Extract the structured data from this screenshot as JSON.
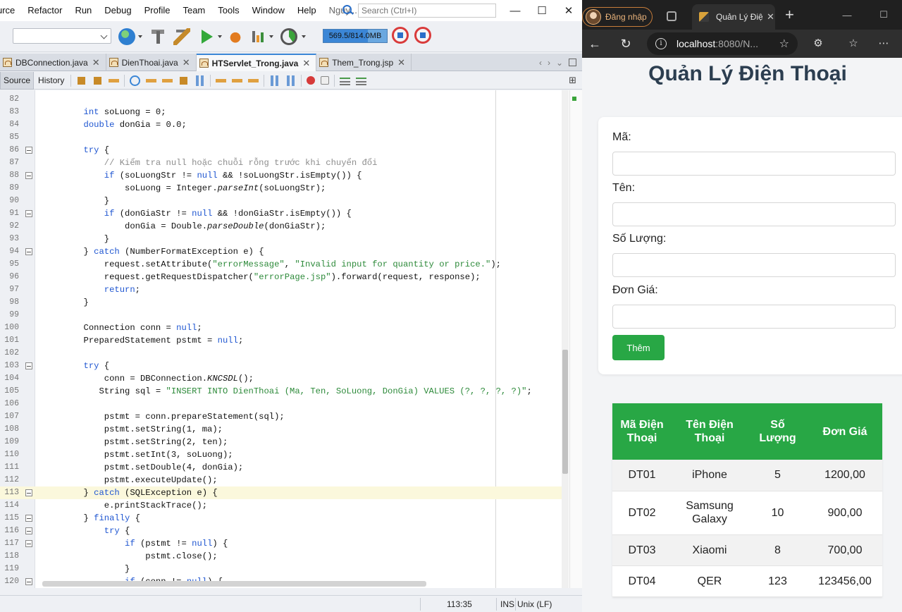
{
  "ide": {
    "menu": [
      "urce",
      "Refactor",
      "Run",
      "Debug",
      "Profile",
      "Team",
      "Tools",
      "Window",
      "Help",
      "Nguy..."
    ],
    "search_placeholder": "Search (Ctrl+I)",
    "memory_label": "569.5/814.0MB",
    "memory_fraction": 0.7,
    "tabs": [
      {
        "label": "DBConnection.java",
        "active": false
      },
      {
        "label": "DienThoai.java",
        "active": false
      },
      {
        "label": "HTServlet_Trong.java",
        "active": true
      },
      {
        "label": "Them_Trong.jsp",
        "active": false
      }
    ],
    "editor_tabs": {
      "source": "Source",
      "history": "History"
    },
    "cursor_line": 113,
    "code": [
      {
        "n": "82",
        "fold": false,
        "t": ""
      },
      {
        "n": "83",
        "fold": false,
        "t": "        <span class=\"kw\">int</span> soLuong = 0;"
      },
      {
        "n": "84",
        "fold": false,
        "t": "        <span class=\"kw\">double</span> donGia = 0.0;"
      },
      {
        "n": "85",
        "fold": false,
        "t": ""
      },
      {
        "n": "86",
        "fold": true,
        "t": "        <span class=\"kw\">try</span> {"
      },
      {
        "n": "87",
        "fold": false,
        "t": "            <span class=\"cmt\">// Kiểm tra null hoặc chuỗi rỗng trước khi chuyển đổi</span>"
      },
      {
        "n": "88",
        "fold": true,
        "t": "            <span class=\"kw\">if</span> (soLuongStr != <span class=\"kw\">null</span> &amp;&amp; !soLuongStr.isEmpty()) {"
      },
      {
        "n": "89",
        "fold": false,
        "t": "                soLuong = Integer.<span class=\"it\">parseInt</span>(soLuongStr);"
      },
      {
        "n": "90",
        "fold": false,
        "t": "            }"
      },
      {
        "n": "91",
        "fold": true,
        "t": "            <span class=\"kw\">if</span> (donGiaStr != <span class=\"kw\">null</span> &amp;&amp; !donGiaStr.isEmpty()) {"
      },
      {
        "n": "92",
        "fold": false,
        "t": "                donGia = Double.<span class=\"it\">parseDouble</span>(donGiaStr);"
      },
      {
        "n": "93",
        "fold": false,
        "t": "            }"
      },
      {
        "n": "94",
        "fold": true,
        "t": "        } <span class=\"kw\">catch</span> (NumberFormatException e) {"
      },
      {
        "n": "95",
        "fold": false,
        "t": "            request.setAttribute(<span class=\"str\">\"errorMessage\"</span>, <span class=\"str\">\"Invalid input for quantity or price.\"</span>);"
      },
      {
        "n": "96",
        "fold": false,
        "t": "            request.getRequestDispatcher(<span class=\"str\">\"errorPage.jsp\"</span>).forward(request, response);"
      },
      {
        "n": "97",
        "fold": false,
        "t": "            <span class=\"kw\">return</span>;"
      },
      {
        "n": "98",
        "fold": false,
        "t": "        }"
      },
      {
        "n": "99",
        "fold": false,
        "t": ""
      },
      {
        "n": "100",
        "fold": false,
        "t": "        Connection conn = <span class=\"kw\">null</span>;"
      },
      {
        "n": "101",
        "fold": false,
        "t": "        PreparedStatement pstmt = <span class=\"kw\">null</span>;"
      },
      {
        "n": "102",
        "fold": false,
        "t": ""
      },
      {
        "n": "103",
        "fold": true,
        "t": "        <span class=\"kw\">try</span> {"
      },
      {
        "n": "104",
        "fold": false,
        "t": "            conn = DBConnection.<span class=\"it\">KNCSDL</span>();"
      },
      {
        "n": "105",
        "fold": false,
        "t": "           String sql = <span class=\"str\">\"INSERT INTO DienThoai (Ma, Ten, SoLuong, DonGia) VALUES (?, ?, ?, ?)\"</span>;"
      },
      {
        "n": "106",
        "fold": false,
        "t": ""
      },
      {
        "n": "107",
        "fold": false,
        "t": "            pstmt = conn.prepareStatement(sql);"
      },
      {
        "n": "108",
        "fold": false,
        "t": "            pstmt.setString(1, ma);"
      },
      {
        "n": "109",
        "fold": false,
        "t": "            pstmt.setString(2, ten);"
      },
      {
        "n": "110",
        "fold": false,
        "t": "            pstmt.setInt(3, soLuong);"
      },
      {
        "n": "111",
        "fold": false,
        "t": "            pstmt.setDouble(4, donGia);"
      },
      {
        "n": "112",
        "fold": false,
        "t": "            pstmt.executeUpdate();"
      },
      {
        "n": "113",
        "fold": true,
        "t": "        } <span class=\"kw\">catch</span> (SQLException e) {"
      },
      {
        "n": "114",
        "fold": false,
        "t": "            e.printStackTrace();"
      },
      {
        "n": "115",
        "fold": true,
        "t": "        } <span class=\"kw\">finally</span> {"
      },
      {
        "n": "116",
        "fold": true,
        "t": "            <span class=\"kw\">try</span> {"
      },
      {
        "n": "117",
        "fold": true,
        "t": "                <span class=\"kw\">if</span> (pstmt != <span class=\"kw\">null</span>) {"
      },
      {
        "n": "118",
        "fold": false,
        "t": "                    pstmt.close();"
      },
      {
        "n": "119",
        "fold": false,
        "t": "                }"
      },
      {
        "n": "120",
        "fold": true,
        "t": "                <span class=\"kw\">if</span> (conn != <span class=\"kw\">null</span>) {"
      }
    ],
    "status": {
      "position": "113:35",
      "mode": "INS",
      "eol": "Unix (LF)"
    }
  },
  "browser": {
    "profile_label": "Đăng nhập",
    "tab_title": "Quản Lý Điện Thoại",
    "url_host": "localhost",
    "url_rest": ":8080/N...",
    "page": {
      "title": "Quản Lý Điện Thoại",
      "form": {
        "ma_label": "Mã:",
        "ten_label": "Tên:",
        "soluong_label": "Số Lượng:",
        "dongia_label": "Đơn Giá:",
        "submit_label": "Thêm"
      },
      "table": {
        "headers": [
          "Mã Điện Thoại",
          "Tên Điện Thoại",
          "Số Lượng",
          "Đơn Giá"
        ],
        "rows": [
          [
            "DT01",
            "iPhone",
            "5",
            "1200,00"
          ],
          [
            "DT02",
            "Samsung Galaxy",
            "10",
            "900,00"
          ],
          [
            "DT03",
            "Xiaomi",
            "8",
            "700,00"
          ],
          [
            "DT04",
            "QER",
            "123",
            "123456,00"
          ]
        ]
      }
    }
  }
}
